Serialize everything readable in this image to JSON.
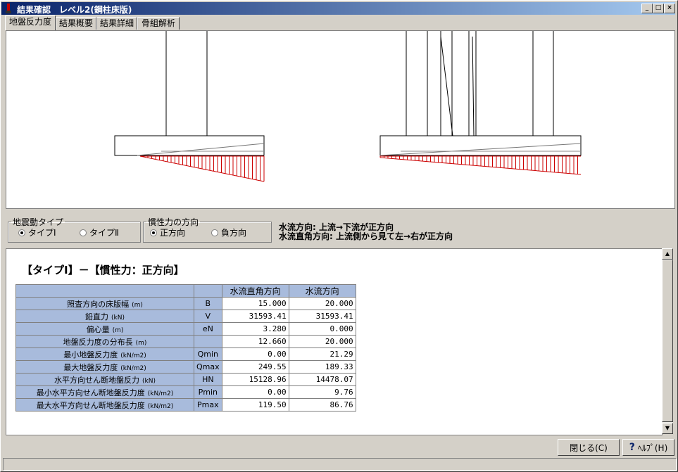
{
  "window": {
    "title": "結果確認　レベル2(鋼柱床版)",
    "minimize": "_",
    "maximize": "□",
    "close": "×"
  },
  "tabs": [
    {
      "label": "地盤反力度",
      "active": true
    },
    {
      "label": "結果概要",
      "active": false
    },
    {
      "label": "結果詳細",
      "active": false
    },
    {
      "label": "骨組解析",
      "active": false
    }
  ],
  "seismic_group": {
    "legend": "地震動タイプ",
    "options": [
      {
        "label": "タイプⅠ",
        "checked": true
      },
      {
        "label": "タイプⅡ",
        "checked": false
      }
    ]
  },
  "inertia_group": {
    "legend": "慣性力の方向",
    "options": [
      {
        "label": "正方向",
        "checked": true
      },
      {
        "label": "負方向",
        "checked": false
      }
    ]
  },
  "notes": [
    "水流方向: 上流→下流が正方向",
    "水流直角方向: 上流側から見て左→右が正方向"
  ],
  "result_heading": "【タイプⅠ】－【慣性力：正方向】",
  "table": {
    "columns": [
      "水流直角方向",
      "水流方向"
    ],
    "rows": [
      {
        "label": "照査方向の床版幅",
        "unit": "(m)",
        "symbol": "B",
        "v1": "15.000",
        "v2": "20.000"
      },
      {
        "label": "鉛直力",
        "unit": "(kN)",
        "symbol": "V",
        "v1": "31593.41",
        "v2": "31593.41"
      },
      {
        "label": "偏心量",
        "unit": "(m)",
        "symbol": "eN",
        "v1": "3.280",
        "v2": "0.000"
      },
      {
        "label": "地盤反力度の分布長",
        "unit": "(m)",
        "symbol": "",
        "v1": "12.660",
        "v2": "20.000"
      },
      {
        "label": "最小地盤反力度",
        "unit": "(kN/m2)",
        "symbol": "Qmin",
        "v1": "0.00",
        "v2": "21.29"
      },
      {
        "label": "最大地盤反力度",
        "unit": "(kN/m2)",
        "symbol": "Qmax",
        "v1": "249.55",
        "v2": "189.33"
      },
      {
        "label": "水平方向せん断地盤反力",
        "unit": "(kN)",
        "symbol": "HN",
        "v1": "15128.96",
        "v2": "14478.07"
      },
      {
        "label": "最小水平方向せん断地盤反力度",
        "unit": "(kN/m2)",
        "symbol": "Pmin",
        "v1": "0.00",
        "v2": "9.76"
      },
      {
        "label": "最大水平方向せん断地盤反力度",
        "unit": "(kN/m2)",
        "symbol": "Pmax",
        "v1": "119.50",
        "v2": "86.76"
      }
    ]
  },
  "buttons": {
    "close": "閉じる(C)",
    "help": "ﾍﾙﾌﾟ(H)"
  },
  "colors": {
    "reaction": "#cc0000",
    "table_header": "#a8bbdc",
    "title_start": "#0a246a"
  }
}
